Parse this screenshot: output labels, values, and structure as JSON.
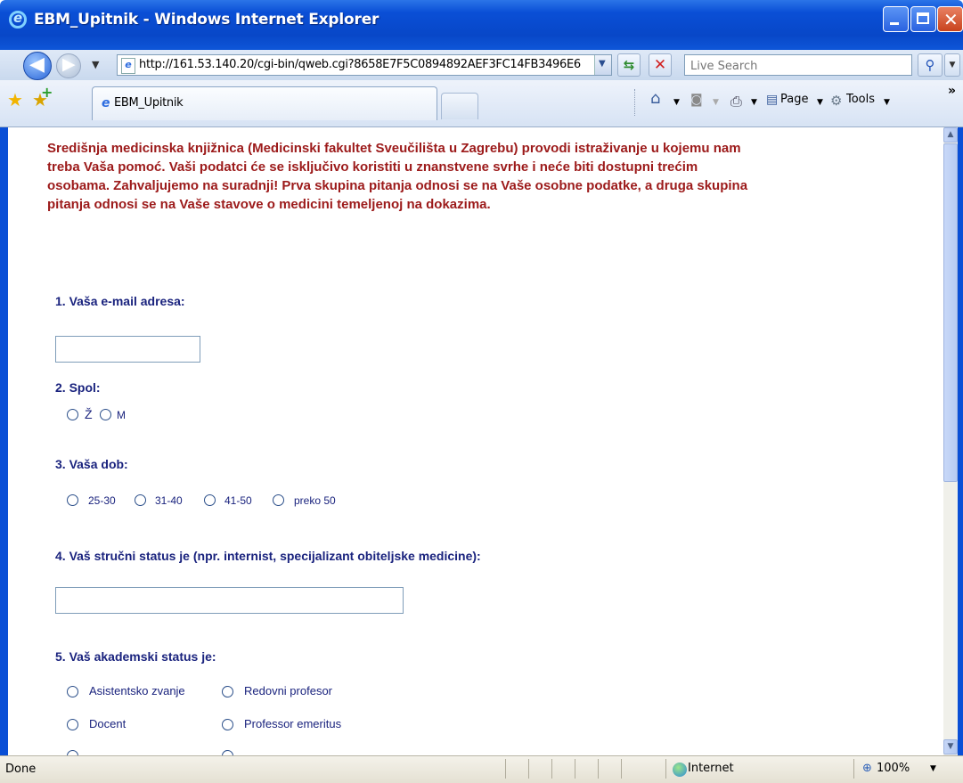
{
  "window": {
    "title": "EBM_Upitnik - Windows Internet Explorer"
  },
  "navbar": {
    "url": "http://161.53.140.20/cgi-bin/qweb.cgi?8658E7F5C0894892AEF3FC14FB3496E6",
    "search_placeholder": "Live Search"
  },
  "tabs": [
    {
      "label": "EBM_Upitnik"
    }
  ],
  "commandbar": {
    "page_label": "Page",
    "tools_label": "Tools"
  },
  "form": {
    "intro": "Središnja medicinska knjižnica (Medicinski fakultet Sveučilišta u Zagrebu) provodi istraživanje u kojemu nam treba Vaša pomoć. Vaši podatci će se isključivo koristiti u znanstvene svrhe i neće biti dostupni trećim osobama. Zahvaljujemo na suradnji! Prva skupina pitanja odnosi se na Vaše osobne podatke, a druga skupina pitanja odnosi se na  Vaše stavove o medicini temeljenoj na dokazima.",
    "q1": {
      "num": "1.",
      "text": " Vaša e-mail adresa:",
      "value": ""
    },
    "q2": {
      "num": "2.",
      "text": " Spol:",
      "options": [
        "Ž",
        "M"
      ]
    },
    "q3": {
      "num": "3.",
      "text": " Vaša dob:",
      "options": [
        "25-30",
        "31-40",
        "41-50",
        "preko 50"
      ]
    },
    "q4": {
      "num": "4.",
      "text": " Vaš  stručni status je (npr. internist, specijalizant obiteljske medicine):",
      "value": ""
    },
    "q5": {
      "num": "5.",
      "text": " Vaš akademski status je:",
      "options": [
        "Asistentsko zvanje",
        "Redovni profesor",
        "Docent",
        "Professor emeritus"
      ]
    }
  },
  "statusbar": {
    "status": "Done",
    "zone": "Internet",
    "zoom": "100%"
  }
}
